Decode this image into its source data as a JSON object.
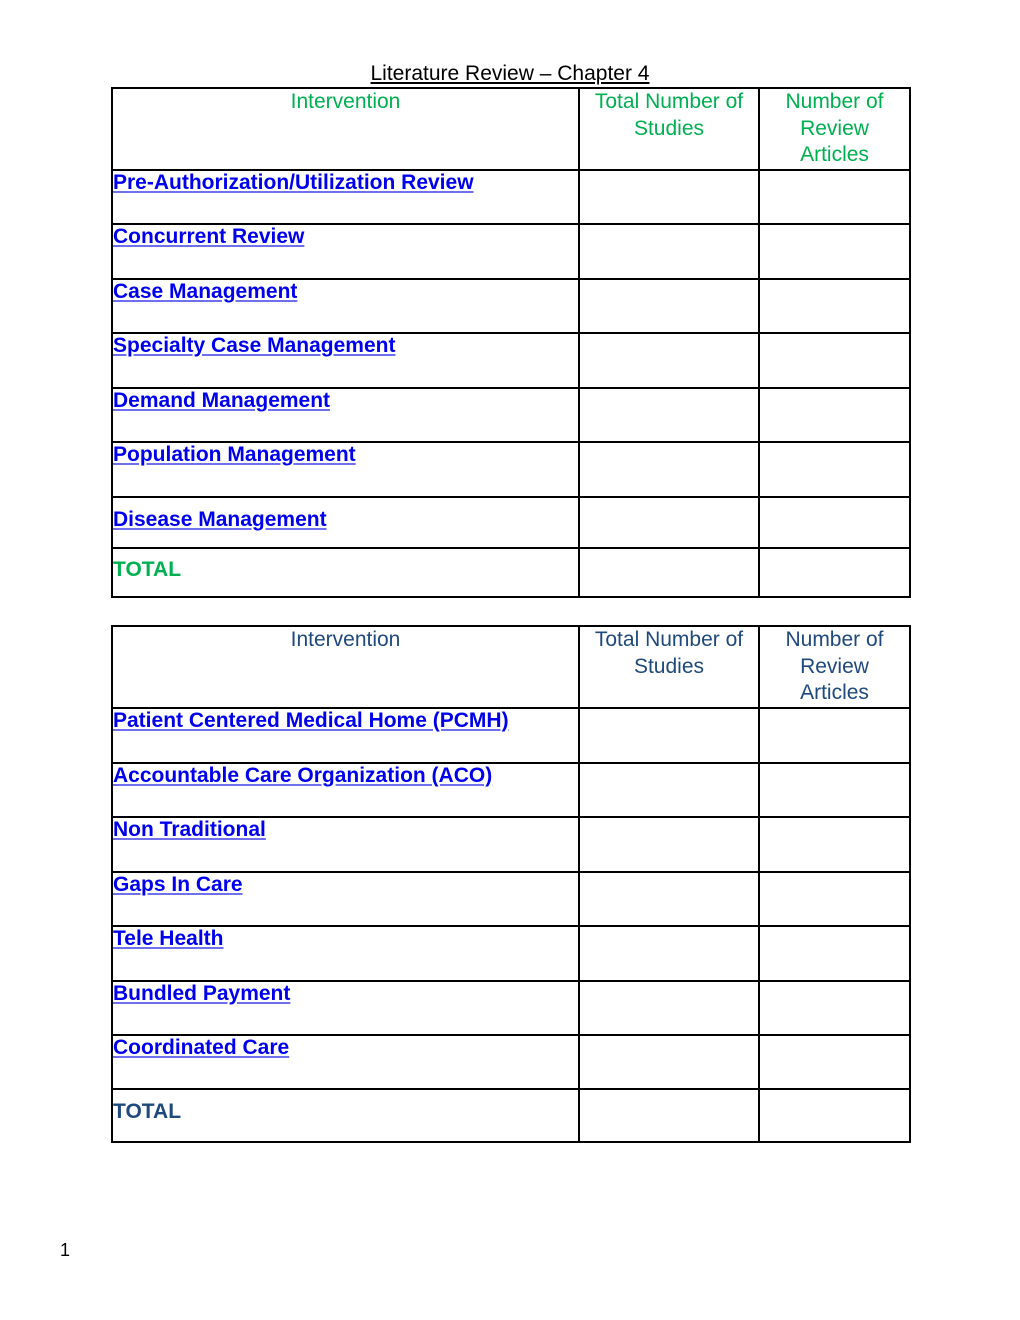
{
  "document": {
    "title": "Literature Review – Chapter 4",
    "page_number": "1",
    "colors": {
      "link": "#0000ee",
      "table1_header": "#00b050",
      "table2_header": "#1f497d"
    }
  },
  "table1": {
    "headers": {
      "intervention": "Intervention",
      "total_studies": "Total Number of Studies",
      "review_articles": "Number of Review Articles"
    },
    "rows": [
      {
        "name": "Pre-Authorization/Utilization Review",
        "total_studies": "",
        "review_articles": ""
      },
      {
        "name": "Concurrent Review",
        "total_studies": "",
        "review_articles": ""
      },
      {
        "name": "Case Management",
        "total_studies": "",
        "review_articles": ""
      },
      {
        "name": "Specialty Case Management",
        "total_studies": "",
        "review_articles": ""
      },
      {
        "name": "Demand Management",
        "total_studies": "",
        "review_articles": ""
      },
      {
        "name": "Population Management",
        "total_studies": "",
        "review_articles": ""
      },
      {
        "name": "Disease Management",
        "total_studies": "",
        "review_articles": ""
      }
    ],
    "total_label": "TOTAL"
  },
  "table2": {
    "headers": {
      "intervention": "Intervention",
      "total_studies": "Total Number of Studies",
      "review_articles": "Number of Review Articles"
    },
    "rows": [
      {
        "name": "Patient Centered Medical Home (PCMH)",
        "total_studies": "",
        "review_articles": ""
      },
      {
        "name": "Accountable Care Organization (ACO)",
        "total_studies": "",
        "review_articles": ""
      },
      {
        "name": "Non Traditional",
        "total_studies": "",
        "review_articles": ""
      },
      {
        "name": "Gaps In Care",
        "total_studies": "",
        "review_articles": ""
      },
      {
        "name": "Tele Health",
        "total_studies": "",
        "review_articles": ""
      },
      {
        "name": "Bundled Payment",
        "total_studies": "",
        "review_articles": ""
      },
      {
        "name": "Coordinated Care",
        "total_studies": "",
        "review_articles": ""
      }
    ],
    "total_label": "TOTAL"
  }
}
